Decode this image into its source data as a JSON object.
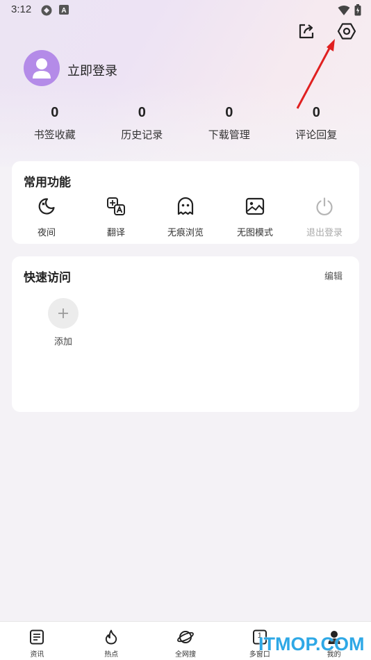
{
  "status_bar": {
    "time": "3:12"
  },
  "profile": {
    "login_text": "立即登录"
  },
  "stats": [
    {
      "value": "0",
      "label": "书签收藏"
    },
    {
      "value": "0",
      "label": "历史记录"
    },
    {
      "value": "0",
      "label": "下载管理"
    },
    {
      "value": "0",
      "label": "评论回复"
    }
  ],
  "common_functions": {
    "title": "常用功能",
    "items": [
      {
        "label": "夜间",
        "icon": "night-mode-icon"
      },
      {
        "label": "翻译",
        "icon": "translate-icon"
      },
      {
        "label": "无痕浏览",
        "icon": "ghost-icon"
      },
      {
        "label": "无图模式",
        "icon": "no-image-icon"
      },
      {
        "label": "退出登录",
        "icon": "power-icon"
      }
    ]
  },
  "quick_access": {
    "title": "快速访问",
    "edit_label": "编辑",
    "add_label": "添加"
  },
  "bottom_nav": [
    {
      "label": "资讯",
      "icon": "news-icon"
    },
    {
      "label": "热点",
      "icon": "flame-icon"
    },
    {
      "label": "全网搜",
      "icon": "planet-icon"
    },
    {
      "label": "多窗口",
      "icon": "windows-icon",
      "badge": "1"
    },
    {
      "label": "我的",
      "icon": "user-icon"
    }
  ],
  "watermark": "ITMOP.COM",
  "colors": {
    "avatar": "#b48be8",
    "annotation_arrow": "#e02020",
    "watermark": "#2ea8e6"
  }
}
